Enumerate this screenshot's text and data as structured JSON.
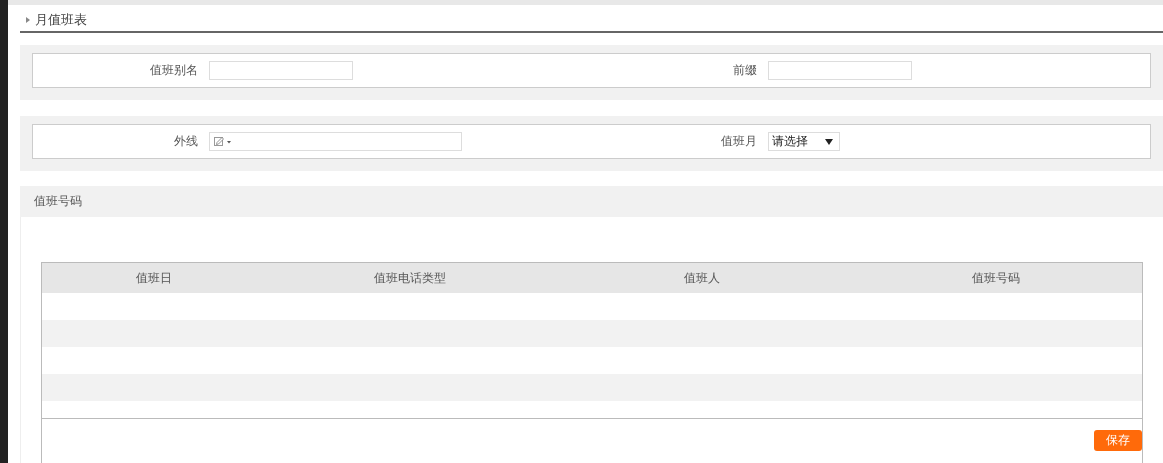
{
  "section_title": "月值班表",
  "form_rows": [
    [
      {
        "label": "值班别名",
        "kind": "text"
      },
      {
        "label": "前缀",
        "kind": "text"
      }
    ],
    [
      {
        "label": "外线",
        "kind": "phone"
      },
      {
        "label": "值班月",
        "kind": "select",
        "value": "请选择"
      }
    ]
  ],
  "panel": {
    "title": "值班号码",
    "table": {
      "columns": [
        "值班日",
        "值班电话类型",
        "值班人",
        "值班号码"
      ]
    }
  },
  "buttons": [
    {
      "label": "保存"
    }
  ]
}
